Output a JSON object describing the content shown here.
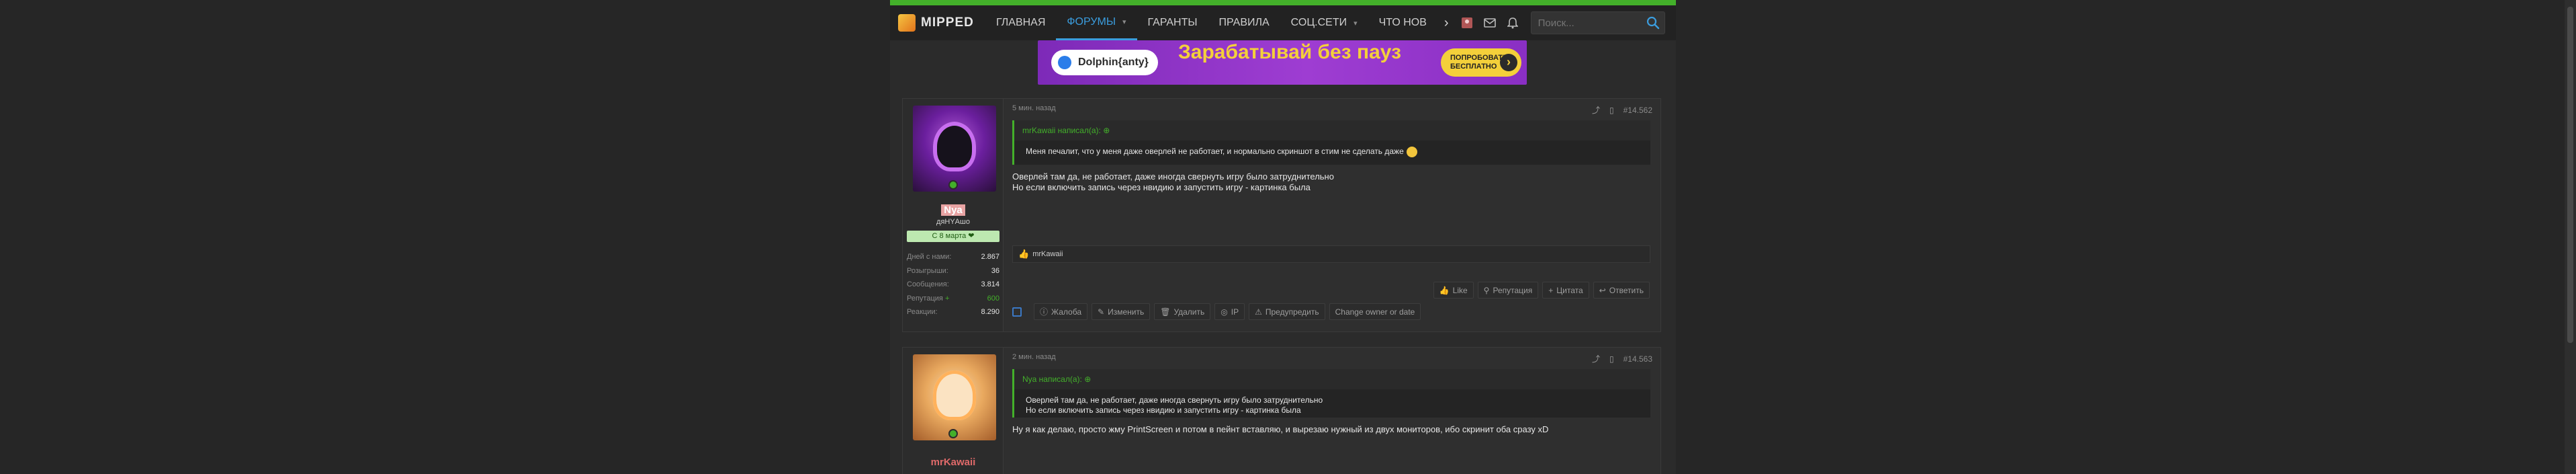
{
  "nav": {
    "logo": "MIPPED",
    "items": [
      {
        "label": "ГЛАВНАЯ"
      },
      {
        "label": "ФОРУМЫ"
      },
      {
        "label": "ГАРАНТЫ"
      },
      {
        "label": "ПРАВИЛА"
      },
      {
        "label": "СОЦ.СЕТИ"
      },
      {
        "label": "ЧТО НОВ"
      }
    ],
    "more": "›",
    "search_placeholder": "Поиск..."
  },
  "banner": {
    "brand": "Dolphin{anty}",
    "title": "Зарабатывай без пауз",
    "cta": "ПОПРОБОВАТЬ БЕСПЛАТНО"
  },
  "colors": {
    "accent": "#43b02a",
    "link": "#3b9dde",
    "banner_bg": "#9e3dd2",
    "banner_text": "#f4d03a"
  },
  "posts": [
    {
      "time": "5 мин. назад",
      "number": "#14.562",
      "user": {
        "name": "Nya",
        "title": "дяНYАшо",
        "badge": "С 8 марта ❤",
        "stats": [
          {
            "k": "Дней с нами:",
            "v": "2.867"
          },
          {
            "k": "Розыгрыши:",
            "v": "36"
          },
          {
            "k": "Сообщения:",
            "v": "3.814"
          },
          {
            "k": "Репутация",
            "v": "600"
          },
          {
            "k": "Реакции:",
            "v": "8.290"
          }
        ]
      },
      "quote_author": "mrKawaii написал(а):",
      "quote_text": "Меня печалит, что у меня даже оверлей не работает, и нормально скриншот в стим не сделать даже",
      "text_line1": "Оверлей там да, не работает, даже иногда свернуть игру было затруднительно",
      "text_line2": "Но если включить запись через нвидию и запустить игру - картинка была",
      "reaction_user": "mrKawaii",
      "actions_right": [
        "Like",
        "Репутация",
        "Цитата",
        "Ответить"
      ],
      "actions_left": [
        "Жалоба",
        "Изменить",
        "Удалить",
        "IP",
        "Предупредить",
        "Change owner or date"
      ]
    },
    {
      "time": "2 мин. назад",
      "number": "#14.563",
      "user": {
        "name": "mrKawaii"
      },
      "quote_author": "Nya написал(а):",
      "quote_line1": "Оверлей там да, не работает, даже иногда свернуть игру было затруднительно",
      "quote_line2": "Но если включить запись через нвидию и запустить игру - картинка была",
      "text_line1": "Ну я как делаю, просто жму PrintScreen и потом в пейнт вставляю, и вырезаю нужный из двух мониторов, ибо скринит оба сразу xD"
    }
  ]
}
